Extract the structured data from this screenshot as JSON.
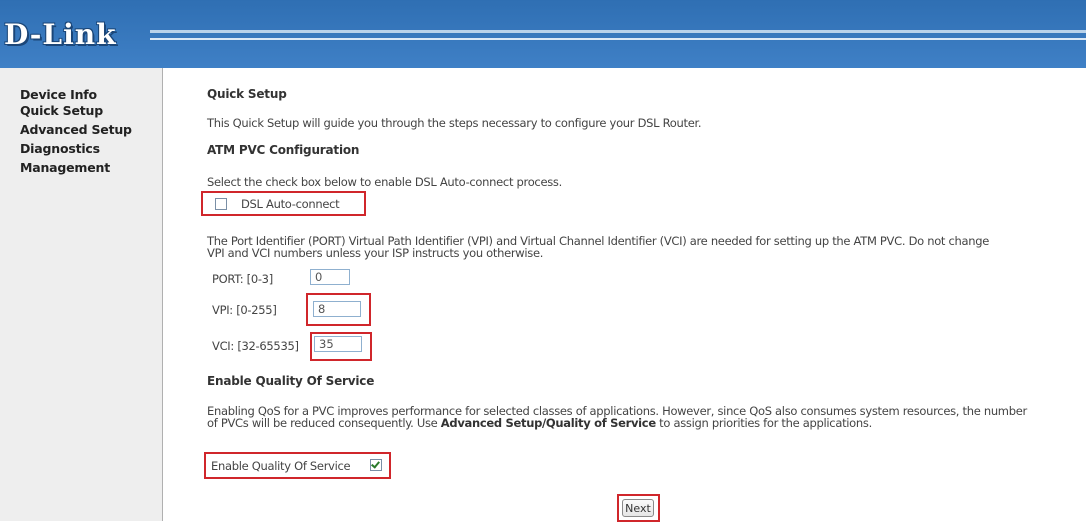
{
  "header": {
    "logo_text": "D-Link",
    "bg_color": "#3b7bc0"
  },
  "sidebar": {
    "items": [
      {
        "label": "Device Info"
      },
      {
        "label": "Quick Setup"
      },
      {
        "label": "Advanced Setup"
      },
      {
        "label": "Diagnostics"
      },
      {
        "label": "Management"
      }
    ]
  },
  "main": {
    "title": "Quick Setup",
    "intro": "This Quick Setup will guide you through the steps necessary to configure your DSL Router.",
    "atm_heading": "ATM PVC Configuration",
    "auto_connect_instruction": "Select the check box below to enable DSL Auto-connect process.",
    "auto_connect_label": "DSL Auto-connect",
    "auto_connect_checked": false,
    "pvc_description_line1": "The Port Identifier (PORT) Virtual Path Identifier (VPI) and Virtual Channel Identifier (VCI) are needed for setting up the ATM PVC. Do not change",
    "pvc_description_line2": "VPI and VCI numbers unless your ISP instructs you otherwise.",
    "fields": {
      "port": {
        "label": "PORT: [0-3]",
        "value": "0"
      },
      "vpi": {
        "label": "VPI: [0-255]",
        "value": "8"
      },
      "vci": {
        "label": "VCI: [32-65535]",
        "value": "35"
      }
    },
    "qos_heading": "Enable Quality Of Service",
    "qos_description_line1": "Enabling QoS for a PVC improves performance for selected classes of applications. However, since QoS also consumes system resources, the number",
    "qos_description_line2_pre": "of PVCs will be reduced consequently. Use ",
    "qos_description_link": "Advanced Setup/Quality of Service",
    "qos_description_line2_post": " to assign priorities for the applications.",
    "qos_checkbox_label": "Enable Quality Of Service",
    "qos_checked": true,
    "next_button": "Next"
  },
  "colors": {
    "highlight_border": "#d0262b",
    "sidebar_bg": "#eeeeee"
  }
}
